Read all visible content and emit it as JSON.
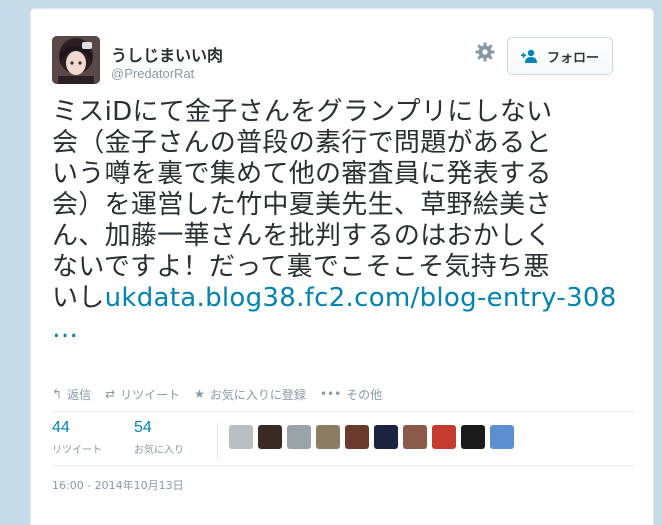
{
  "user": {
    "display_name": "うしじまいい肉",
    "handle": "@PredatorRat",
    "avatar_icon": "user-avatar"
  },
  "follow_button": {
    "label": "フォロー",
    "icon": "add-user-icon"
  },
  "settings_icon": "gear-icon",
  "tweet": {
    "lines": [
      "ミスiDにて金子さんをグランプリにしない",
      "会（金子さんの普段の素行で問題があると",
      "いう噂を裏で集めて他の審査員に発表する",
      "会）を運営した竹中夏美先生、草野絵美さ",
      "ん、加藤一華さんを批判するのはおかしく",
      "ないですよ！だって裏でこそこそ気持ち悪"
    ],
    "last_line_prefix": "いし",
    "link_text": "ukdata.blog38.fc2.com/blog-entry-308",
    "ellipsis": "…"
  },
  "actions": [
    {
      "label": "返信",
      "icon": "reply-icon",
      "glyph": "↰"
    },
    {
      "label": "リツイート",
      "icon": "retweet-icon",
      "glyph": "⇄"
    },
    {
      "label": "お気に入りに登録",
      "icon": "star-icon",
      "glyph": "★"
    },
    {
      "label": "その他",
      "icon": "more-icon",
      "glyph": "•••"
    }
  ],
  "stats": {
    "retweets": {
      "count": "44",
      "label": "リツイート"
    },
    "favorites": {
      "count": "54",
      "label": "お気に入り"
    }
  },
  "favoriters": [
    {
      "color": "#b7bec4"
    },
    {
      "color": "#3a2a26"
    },
    {
      "color": "#9aa4a8"
    },
    {
      "color": "#8b7c63"
    },
    {
      "color": "#6b3a2c"
    },
    {
      "color": "#1c2340"
    },
    {
      "color": "#8a5a4a"
    },
    {
      "color": "#c53b2e"
    },
    {
      "color": "#1a1a1a"
    },
    {
      "color": "#5c8fcf"
    }
  ],
  "timestamp": "16:00 - 2014年10月13日",
  "colors": {
    "link": "#0084b4",
    "muted": "#8899a6",
    "text": "#292f33",
    "background": "#c5dbe8"
  }
}
